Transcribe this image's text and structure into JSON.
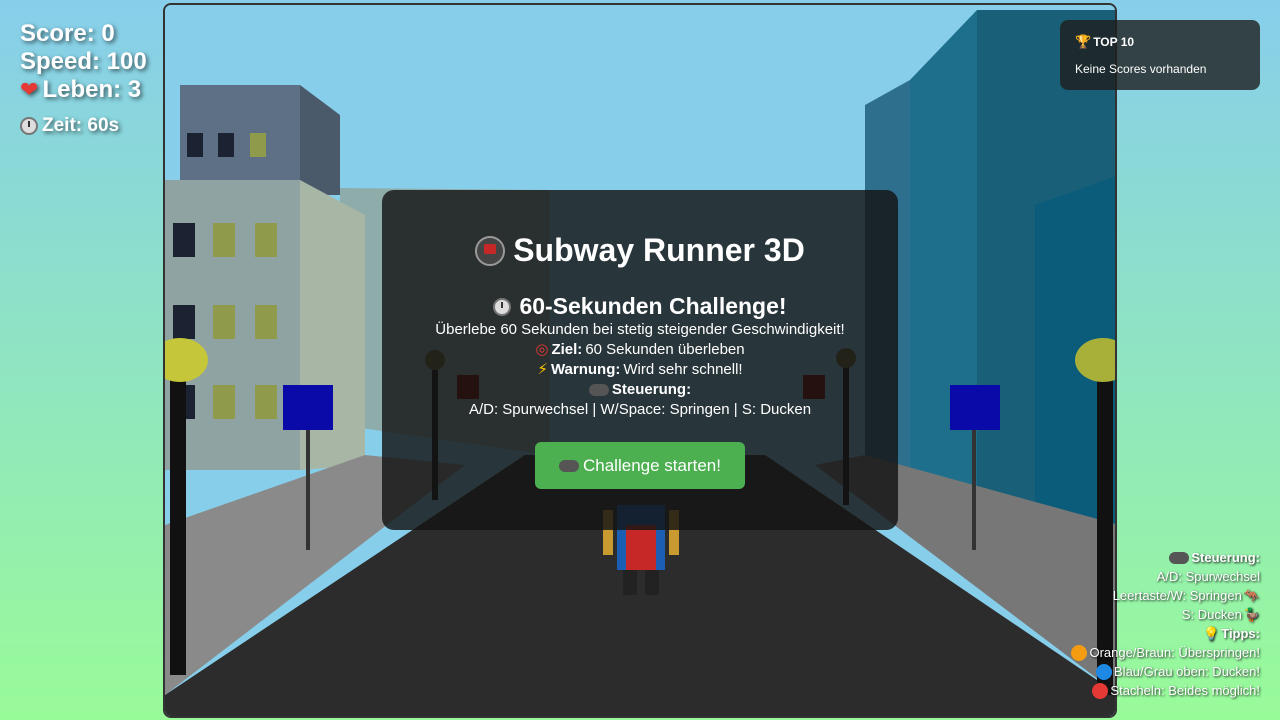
{
  "hud": {
    "score": "Score: 0",
    "speed": "Speed: 100",
    "lives": "Leben: 3",
    "time": "Zeit: 60s"
  },
  "leaderboard": {
    "title": "TOP 10",
    "empty": "Keine Scores vorhanden"
  },
  "modal": {
    "title": "Subway Runner 3D",
    "subtitle": "60-Sekunden Challenge!",
    "intro": "Überlebe 60 Sekunden bei stetig steigender Geschwindigkeit!",
    "goal_label": "Ziel:",
    "goal_text": "60 Sekunden überleben",
    "warn_label": "Warnung:",
    "warn_text": "Wird sehr schnell!",
    "controls_label": "Steuerung:",
    "controls_text": "A/D: Spurwechsel | W/Space: Springen | S: Ducken",
    "start_button": "Challenge starten!"
  },
  "help": {
    "controls_label": "Steuerung:",
    "line1": "A/D: Spurwechsel",
    "line2": "Leertaste/W: Springen",
    "line3": "S: Ducken",
    "tips_label": "Tipps:",
    "tip1": "Orange/Braun: Überspringen!",
    "tip2": "Blau/Grau oben: Ducken!",
    "tip3": "Stacheln: Beides möglich!"
  },
  "colors": {
    "accent_green": "#4caf50",
    "sky": "#87ceeb",
    "page_bottom": "#98fb98"
  },
  "icons": [
    "heart-icon",
    "stopwatch-icon",
    "trophy-icon",
    "train-icon",
    "target-icon",
    "bolt-icon",
    "gamepad-icon",
    "kangaroo-icon",
    "duck-icon",
    "lightbulb-icon",
    "orange-dot-icon",
    "blue-dot-icon",
    "red-dot-icon"
  ]
}
